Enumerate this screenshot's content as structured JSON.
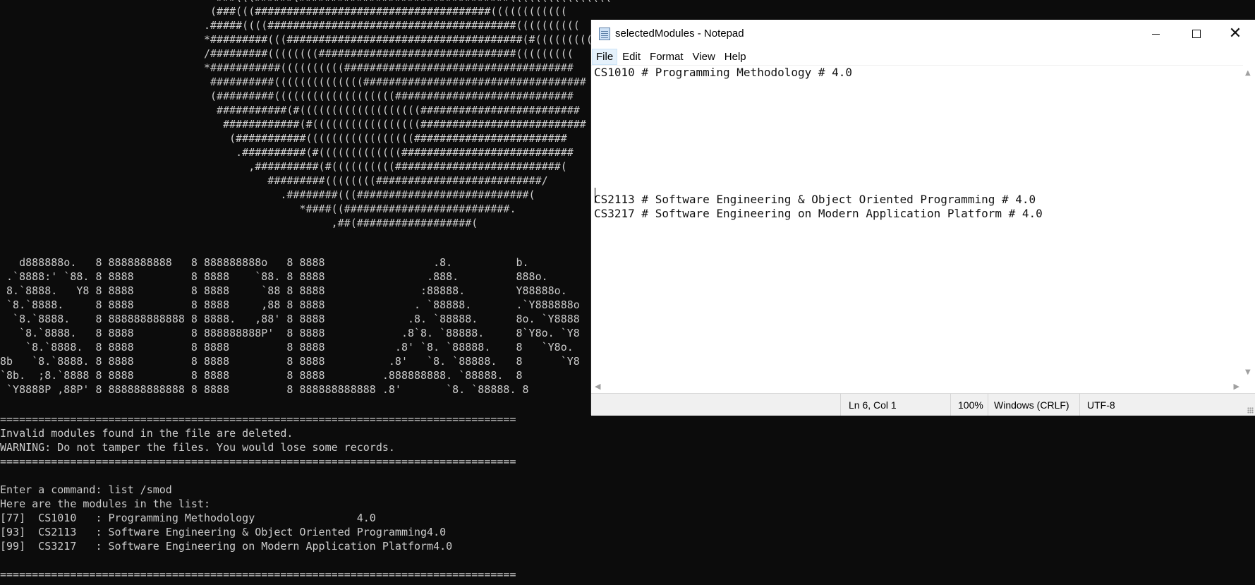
{
  "console": {
    "ascii_logo": "                                  ###(((######(#################################((((((((((((((((\n                                 (###(((#####################################((((((((((((\n                                .#####((((#######################################((((((((((\n                                *#########(((#####################################(#(((((((((\n                                /#########((((((((###############################(((((((((\n                                *###########((((((((((####################################\n                                 ##########((((((((((((((###################################\n                                 (#########(((((((((((((((((((############################\n                                  ###########(#(((((((((((((((((((#########################\n                                   ############(#(((((((((((((((((##########################\n                                    (###########(((((((((((((((((########################\n                                     .##########(#(((((((((((((###########################\n                                       ,##########(#((((((((((##########################(\n                                          #########((((((((##########################/\n                                            .########(((###########################(\n                                               *####((##########################.\n                                                    ,##(##################(",
    "ascii_title": "   d888888o.   8 8888888888   8 888888888o   8 8888                 .8.          b.\n .`8888:' `88. 8 8888         8 8888    `88. 8 8888                .888.         888o.\n 8.`8888.   Y8 8 8888         8 8888     `88 8 8888               :88888.        Y88888o.\n `8.`8888.     8 8888         8 8888     ,88 8 8888              . `88888.       .`Y888888o\n  `8.`8888.    8 888888888888 8 8888.   ,88' 8 8888             .8. `88888.      8o. `Y8888\n   `8.`8888.   8 8888         8 888888888P'  8 8888            .8`8. `88888.     8`Y8o. `Y8\n    `8.`8888.  8 8888         8 8888         8 8888           .8' `8. `88888.    8   `Y8o.\n8b   `8.`8888. 8 8888         8 8888         8 8888          .8'   `8. `88888.   8      `Y8\n`8b.  ;8.`8888 8 8888         8 8888         8 8888         .888888888. `88888.  8\n `Y8888P ,88P' 8 888888888888 8 8888         8 888888888888 .8'       `8. `88888. 8",
    "output": "=================================================================================\nInvalid modules found in the file are deleted.\nWARNING: Do not tamper the files. You would lose some records.\n=================================================================================\n\nEnter a command: list /smod\nHere are the modules in the list:\n[77]  CS1010   : Programming Methodology                4.0\n[93]  CS2113   : Software Engineering & Object Oriented Programming4.0\n[99]  CS3217   : Software Engineering on Modern Application Platform4.0\n\n================================================================================="
  },
  "notepad": {
    "title": "selectedModules - Notepad",
    "menu": [
      "File",
      "Edit",
      "Format",
      "View",
      "Help"
    ],
    "content": "CS1010 # Programming Methodology # 4.0\n\n\n\n\n\n\n\n\nCS2113 # Software Engineering & Object Oriented Programming # 4.0\nCS3217 # Software Engineering on Modern Application Platform # 4.0",
    "status": {
      "position": "Ln 6, Col 1",
      "zoom": "100%",
      "line_ending": "Windows (CRLF)",
      "encoding": "UTF-8"
    }
  }
}
